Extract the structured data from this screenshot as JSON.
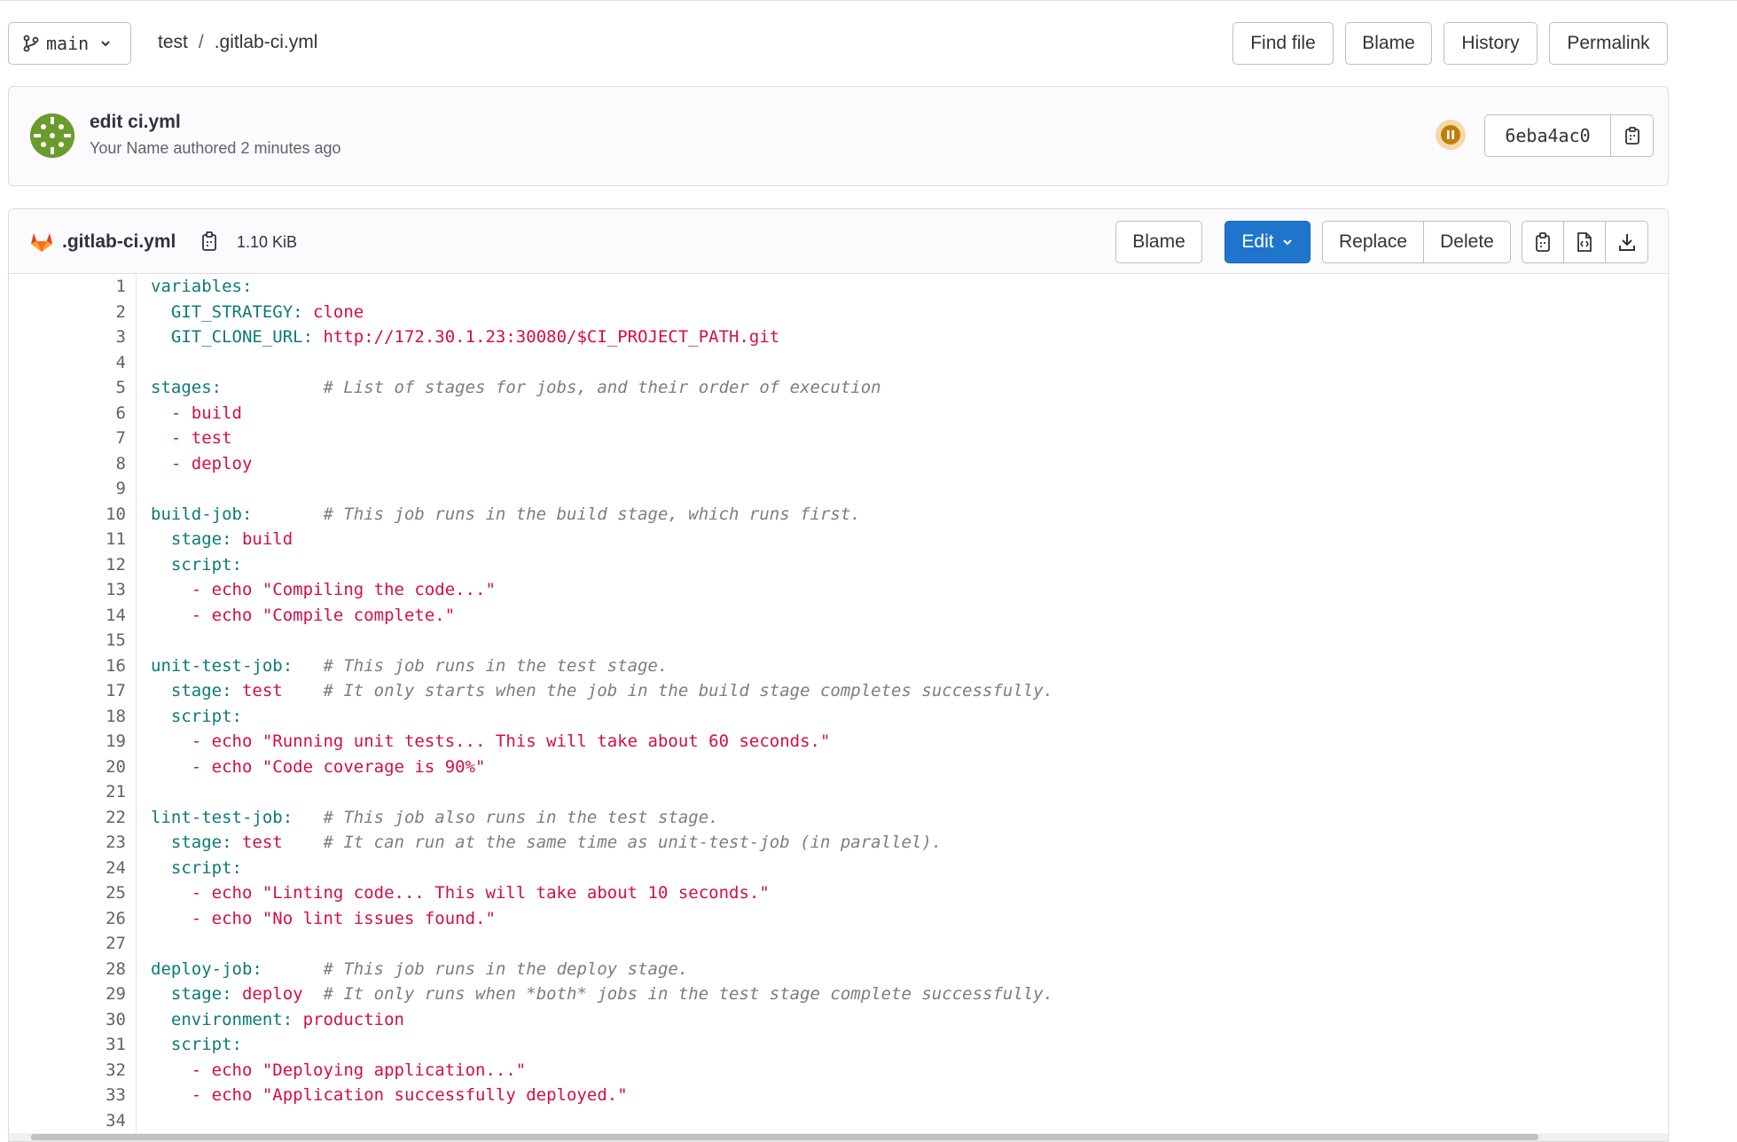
{
  "header": {
    "branch": "main",
    "breadcrumb": [
      "test",
      ".gitlab-ci.yml"
    ],
    "buttons": {
      "find_file": "Find file",
      "blame": "Blame",
      "history": "History",
      "permalink": "Permalink"
    }
  },
  "commit": {
    "title": "edit ci.yml",
    "meta": "Your Name authored 2 minutes ago",
    "sha": "6eba4ac0",
    "pipeline_status": "paused"
  },
  "file": {
    "name": ".gitlab-ci.yml",
    "size": "1.10 KiB",
    "buttons": {
      "blame": "Blame",
      "edit": "Edit",
      "replace": "Replace",
      "delete": "Delete"
    }
  },
  "code": [
    {
      "n": "1",
      "t": [
        [
          "k",
          "variables:"
        ]
      ]
    },
    {
      "n": "2",
      "t": [
        [
          "k",
          "  GIT_STRATEGY:"
        ],
        [
          "s",
          " clone"
        ]
      ]
    },
    {
      "n": "3",
      "t": [
        [
          "k",
          "  GIT_CLONE_URL:"
        ],
        [
          "s",
          " http://172.30.1.23:30080/$CI_PROJECT_PATH.git"
        ]
      ]
    },
    {
      "n": "4",
      "t": []
    },
    {
      "n": "5",
      "t": [
        [
          "k",
          "stages:"
        ],
        [
          "c",
          "          # List of stages for jobs, and their order of execution"
        ]
      ]
    },
    {
      "n": "6",
      "t": [
        [
          "s",
          "  - build"
        ]
      ]
    },
    {
      "n": "7",
      "t": [
        [
          "s",
          "  - test"
        ]
      ]
    },
    {
      "n": "8",
      "t": [
        [
          "s",
          "  - deploy"
        ]
      ]
    },
    {
      "n": "9",
      "t": []
    },
    {
      "n": "10",
      "t": [
        [
          "k",
          "build-job:"
        ],
        [
          "c",
          "       # This job runs in the build stage, which runs first."
        ]
      ]
    },
    {
      "n": "11",
      "t": [
        [
          "k",
          "  stage:"
        ],
        [
          "s",
          " build"
        ]
      ]
    },
    {
      "n": "12",
      "t": [
        [
          "k",
          "  script:"
        ]
      ]
    },
    {
      "n": "13",
      "t": [
        [
          "s",
          "    - echo \"Compiling the code...\""
        ]
      ]
    },
    {
      "n": "14",
      "t": [
        [
          "s",
          "    - echo \"Compile complete.\""
        ]
      ]
    },
    {
      "n": "15",
      "t": []
    },
    {
      "n": "16",
      "t": [
        [
          "k",
          "unit-test-job:"
        ],
        [
          "c",
          "   # This job runs in the test stage."
        ]
      ]
    },
    {
      "n": "17",
      "t": [
        [
          "k",
          "  stage:"
        ],
        [
          "s",
          " test"
        ],
        [
          "c",
          "    # It only starts when the job in the build stage completes successfully."
        ]
      ]
    },
    {
      "n": "18",
      "t": [
        [
          "k",
          "  script:"
        ]
      ]
    },
    {
      "n": "19",
      "t": [
        [
          "s",
          "    - echo \"Running unit tests... This will take about 60 seconds.\""
        ]
      ]
    },
    {
      "n": "20",
      "t": [
        [
          "s",
          "    - echo \"Code coverage is 90%\""
        ]
      ]
    },
    {
      "n": "21",
      "t": []
    },
    {
      "n": "22",
      "t": [
        [
          "k",
          "lint-test-job:"
        ],
        [
          "c",
          "   # This job also runs in the test stage."
        ]
      ]
    },
    {
      "n": "23",
      "t": [
        [
          "k",
          "  stage:"
        ],
        [
          "s",
          " test"
        ],
        [
          "c",
          "    # It can run at the same time as unit-test-job (in parallel)."
        ]
      ]
    },
    {
      "n": "24",
      "t": [
        [
          "k",
          "  script:"
        ]
      ]
    },
    {
      "n": "25",
      "t": [
        [
          "s",
          "    - echo \"Linting code... This will take about 10 seconds.\""
        ]
      ]
    },
    {
      "n": "26",
      "t": [
        [
          "s",
          "    - echo \"No lint issues found.\""
        ]
      ]
    },
    {
      "n": "27",
      "t": []
    },
    {
      "n": "28",
      "t": [
        [
          "k",
          "deploy-job:"
        ],
        [
          "c",
          "      # This job runs in the deploy stage."
        ]
      ]
    },
    {
      "n": "29",
      "t": [
        [
          "k",
          "  stage:"
        ],
        [
          "s",
          " deploy"
        ],
        [
          "c",
          "  # It only runs when *both* jobs in the test stage complete successfully."
        ]
      ]
    },
    {
      "n": "30",
      "t": [
        [
          "k",
          "  environment:"
        ],
        [
          "s",
          " production"
        ]
      ]
    },
    {
      "n": "31",
      "t": [
        [
          "k",
          "  script:"
        ]
      ]
    },
    {
      "n": "32",
      "t": [
        [
          "s",
          "    - echo \"Deploying application...\""
        ]
      ]
    },
    {
      "n": "33",
      "t": [
        [
          "s",
          "    - echo \"Application successfully deployed.\""
        ]
      ]
    },
    {
      "n": "34",
      "t": []
    }
  ],
  "colors": {
    "primary": "#1f75cb",
    "key": "#0b7a75",
    "string": "#d40d49",
    "comment": "#7d7c82"
  }
}
